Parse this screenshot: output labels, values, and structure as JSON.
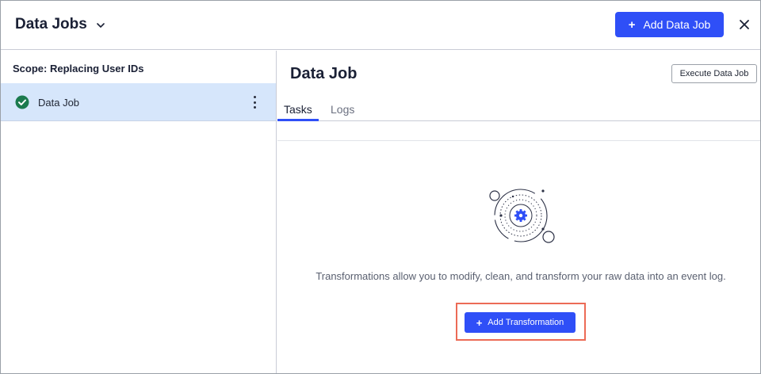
{
  "header": {
    "title": "Data Jobs",
    "add_button_label": "Add Data Job",
    "add_button_icon": "plus-icon",
    "close_icon": "close-icon"
  },
  "sidebar": {
    "scope_label": "Scope: Replacing User IDs",
    "items": [
      {
        "label": "Data Job",
        "status": "success",
        "status_color": "#1b7a4e"
      }
    ]
  },
  "main": {
    "title": "Data Job",
    "execute_button_label": "Execute Data Job",
    "tabs": [
      {
        "label": "Tasks",
        "active": true
      },
      {
        "label": "Logs",
        "active": false
      }
    ],
    "empty_state": {
      "description": "Transformations allow you to modify, clean, and transform your raw data into an event log.",
      "button_label": "Add Transformation",
      "highlight_color": "#ec6b56"
    }
  },
  "colors": {
    "accent": "#2f4ff7",
    "selected_row": "#d6e6fb"
  }
}
